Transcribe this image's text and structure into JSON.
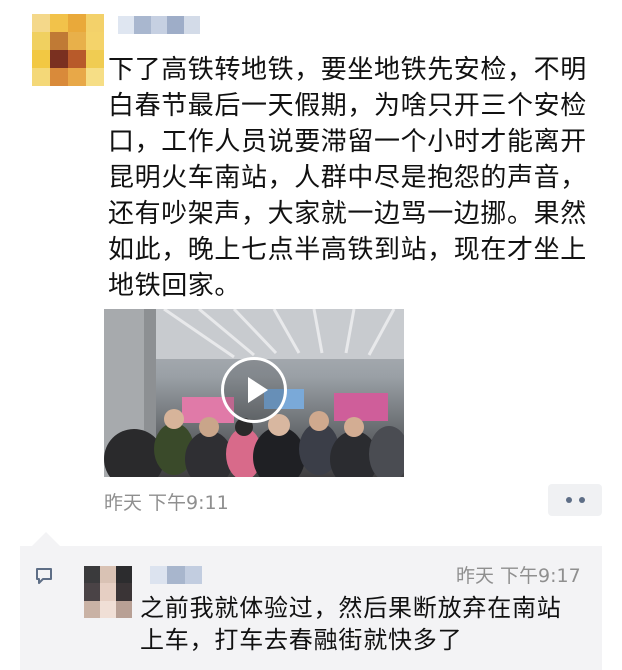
{
  "post": {
    "author_avatar": "pixelated-avatar",
    "author_name": "",
    "text": "下了高铁转地铁，要坐地铁先安检，不明白春节最后一天假期，为啥只开三个安检口，工作人员说要滞留一个小时才能离开昆明火车南站，人群中尽是抱怨的声音，还有吵架声，大家就一边骂一边挪。果然如此，晚上七点半高铁到站，现在才坐上地铁回家。",
    "media": {
      "type": "video",
      "icon": "play-icon"
    },
    "timestamp": "昨天  下午9:11",
    "more_icon": "more-dots-icon"
  },
  "comment": {
    "icon": "comment-bubble-icon",
    "author_avatar": "pixelated-avatar",
    "author_name": "",
    "timestamp": "昨天  下午9:17",
    "text": "之前我就体验过，然后果断放弃在南站上车，打车去春融街就快多了"
  },
  "colors": {
    "text": "#111111",
    "meta": "#8f8f8f",
    "comment_bg": "#f3f3f5",
    "link_blue": "#5e6e86"
  }
}
